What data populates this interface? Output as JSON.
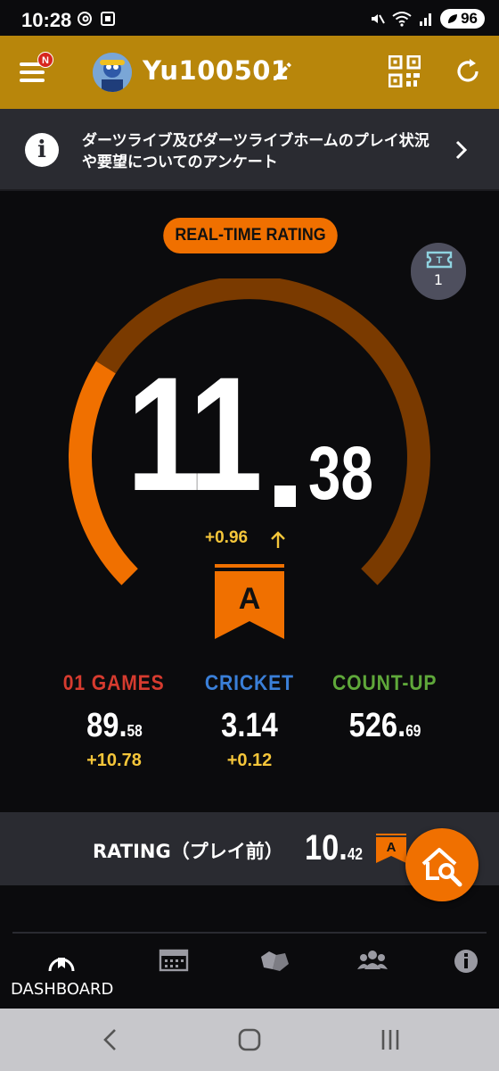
{
  "status_bar": {
    "time": "10:28",
    "battery": "96"
  },
  "header": {
    "username": "Yu100501",
    "menu_badge": "N"
  },
  "notice": {
    "text": "ダーツライブ及びダーツライブホームのプレイ状況や要望についてのアンケート"
  },
  "realtime": {
    "pill_label": "REAL-TIME RATING",
    "ticket_count": "1",
    "rating_int": "11",
    "rating_dec": "38",
    "delta": "+0.96",
    "class_letter": "A",
    "gauge_fraction": 0.15
  },
  "stats": [
    {
      "label": "01 GAMES",
      "value_int": "89.",
      "value_dec": "58",
      "delta": "+10.78",
      "color": "#d63b2f"
    },
    {
      "label": "CRICKET",
      "value_int": "3.14",
      "value_dec": "",
      "delta": "+0.12",
      "color": "#3a7fd8"
    },
    {
      "label": "COUNT-UP",
      "value_int": "526.",
      "value_dec": "69",
      "delta": "",
      "color": "#5fa83a"
    }
  ],
  "previous": {
    "label": "RATING（プレイ前）",
    "value_int": "10.",
    "value_dec": "42",
    "class_letter": "A"
  },
  "bottom_nav": {
    "dashboard_label": "DASHBOARD"
  },
  "colors": {
    "header": "#b8860b",
    "accent": "#f07000",
    "gauge_dark": "#7a3a00",
    "delta": "#f5c63a"
  }
}
